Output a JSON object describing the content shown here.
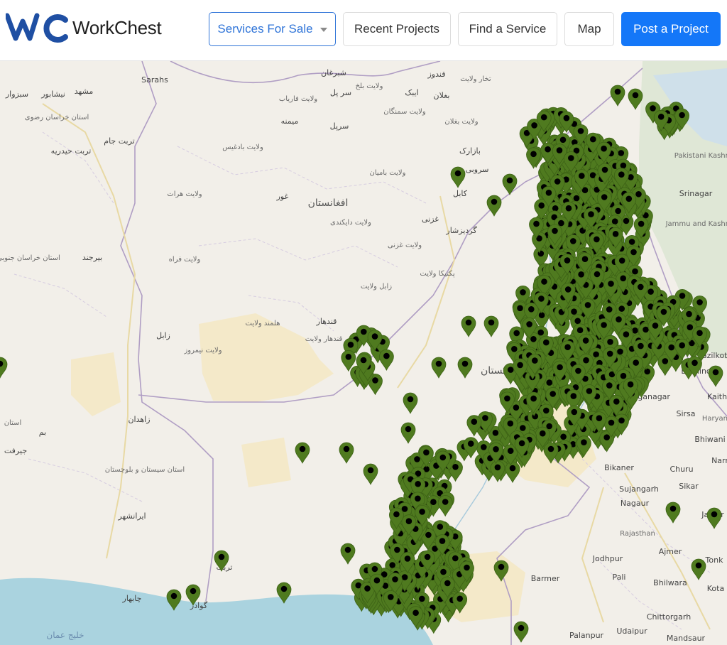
{
  "brand": {
    "name": "WorkChest",
    "accent": "#1477f8",
    "logo_color": "#1f4fa3"
  },
  "nav": {
    "services_for_sale": "Services For Sale",
    "recent_projects": "Recent Projects",
    "find_service": "Find a Service",
    "map": "Map",
    "post_project": "Post a Project"
  },
  "map": {
    "marker_color": "#4f7a1f",
    "labels": [
      {
        "text": "Sarahs"
      },
      {
        "text": "مشهد"
      },
      {
        "text": "نیشابور"
      },
      {
        "text": "سبزوار"
      },
      {
        "text": "استان خراسان رضوی"
      },
      {
        "text": "تربت جام"
      },
      {
        "text": "تربت حیدریه"
      },
      {
        "text": "شبرغان"
      },
      {
        "text": "سر پل"
      },
      {
        "text": "ولایت بلخ"
      },
      {
        "text": "قندوز"
      },
      {
        "text": "تخار ولایت"
      },
      {
        "text": "ایبک"
      },
      {
        "text": "بغلان"
      },
      {
        "text": "ولایت سمنگان"
      },
      {
        "text": "ولایت فاریاب"
      },
      {
        "text": "میمنه"
      },
      {
        "text": "سرپل"
      },
      {
        "text": "ولایت بغلان"
      },
      {
        "text": "ولایت بادغیس"
      },
      {
        "text": "بازارک"
      },
      {
        "text": "ولایت هرات"
      },
      {
        "text": "ولایت بامیان"
      },
      {
        "text": "سروبی"
      },
      {
        "text": "کابل"
      },
      {
        "text": "غور"
      },
      {
        "text": "افغانستان"
      },
      {
        "text": "ولایت دایکندی"
      },
      {
        "text": "غزنی"
      },
      {
        "text": "گردیزشار"
      },
      {
        "text": "ولایت غزنی"
      },
      {
        "text": "استان خراسان جنوبی"
      },
      {
        "text": "بیرجند"
      },
      {
        "text": "ولایت فراه"
      },
      {
        "text": "پکتیکا ولایت"
      },
      {
        "text": "زابل ولایت"
      },
      {
        "text": "قندهار"
      },
      {
        "text": "هلمند ولایت"
      },
      {
        "text": "قندهار ولایت"
      },
      {
        "text": "زابل"
      },
      {
        "text": "ولایت نیمروز"
      },
      {
        "text": "زاهدان"
      },
      {
        "text": "استان"
      },
      {
        "text": "بم"
      },
      {
        "text": "جیرفت"
      },
      {
        "text": "استان سیستان و بلوچستان"
      },
      {
        "text": "ایرانشهر"
      },
      {
        "text": "تربت"
      },
      {
        "text": "چابهار"
      },
      {
        "text": "گوادر"
      },
      {
        "text": "خلیج عمان"
      },
      {
        "text": "پاکستان"
      },
      {
        "text": "Srinagar"
      },
      {
        "text": "Jammu and Kashmir"
      },
      {
        "text": "Pakistani Kashmir"
      },
      {
        "text": "Fazilkot"
      },
      {
        "text": "Bathinda"
      },
      {
        "text": "Ganganagar"
      },
      {
        "text": "Kaith"
      },
      {
        "text": "Sirsa"
      },
      {
        "text": "Haryana"
      },
      {
        "text": "Bhiwani"
      },
      {
        "text": "Bikaner"
      },
      {
        "text": "Churu"
      },
      {
        "text": "Sujangarh"
      },
      {
        "text": "Sikar"
      },
      {
        "text": "Nagaur"
      },
      {
        "text": "Jaipur"
      },
      {
        "text": "Rajasthan"
      },
      {
        "text": "Ajmer"
      },
      {
        "text": "Jodhpur"
      },
      {
        "text": "Pali"
      },
      {
        "text": "Bhilwara"
      },
      {
        "text": "Kota"
      },
      {
        "text": "Tonk"
      },
      {
        "text": "Barmer"
      },
      {
        "text": "Chittorgarh"
      },
      {
        "text": "Udaipur"
      },
      {
        "text": "Palanpur"
      },
      {
        "text": "Mandsaur"
      },
      {
        "text": "Narr"
      }
    ]
  }
}
